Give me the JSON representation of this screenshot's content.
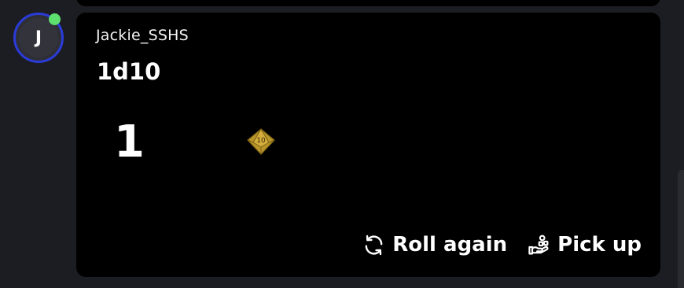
{
  "message": {
    "user": {
      "avatar_initial": "J",
      "username": "Jackie_SSHS",
      "online": true
    },
    "roll": {
      "formula": "1d10",
      "result": "1",
      "die_label": "10",
      "die_color": "#b8962a"
    },
    "actions": {
      "roll_again_label": "Roll again",
      "pick_up_label": "Pick up"
    }
  },
  "colors": {
    "background": "#1c1d22",
    "card": "#000000",
    "avatar_ring": "#2a3bd8",
    "online": "#5ee06e"
  }
}
